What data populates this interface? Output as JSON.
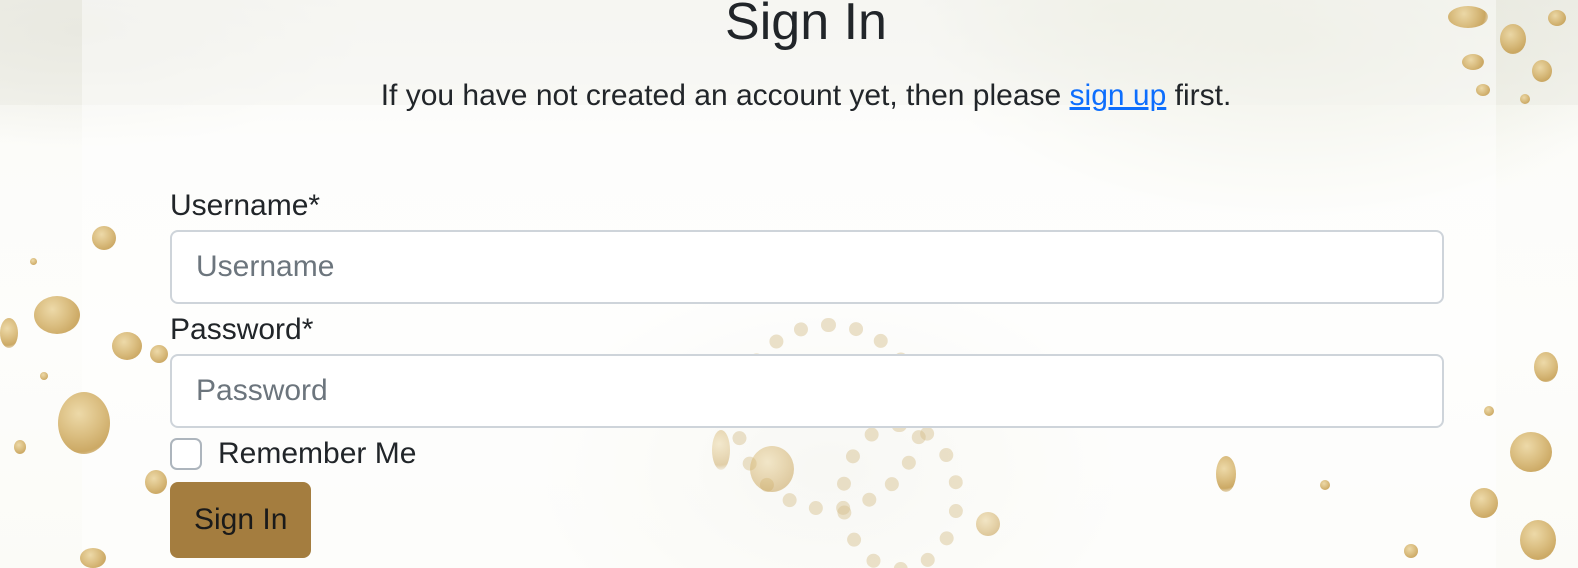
{
  "header": {
    "title": "Sign In",
    "intro_before": "If you have not created an account yet, then please ",
    "signup_link": "sign up",
    "intro_after": " first."
  },
  "form": {
    "username": {
      "label": "Username*",
      "placeholder": "Username",
      "value": ""
    },
    "password": {
      "label": "Password*",
      "placeholder": "Password",
      "value": ""
    },
    "remember": {
      "label": "Remember Me",
      "checked": false
    },
    "submit_label": "Sign In"
  },
  "colors": {
    "accent_button": "#a47d3f",
    "link": "#0d6efd",
    "text": "#212529",
    "placeholder": "#6c757d",
    "input_border": "#ced4da"
  }
}
